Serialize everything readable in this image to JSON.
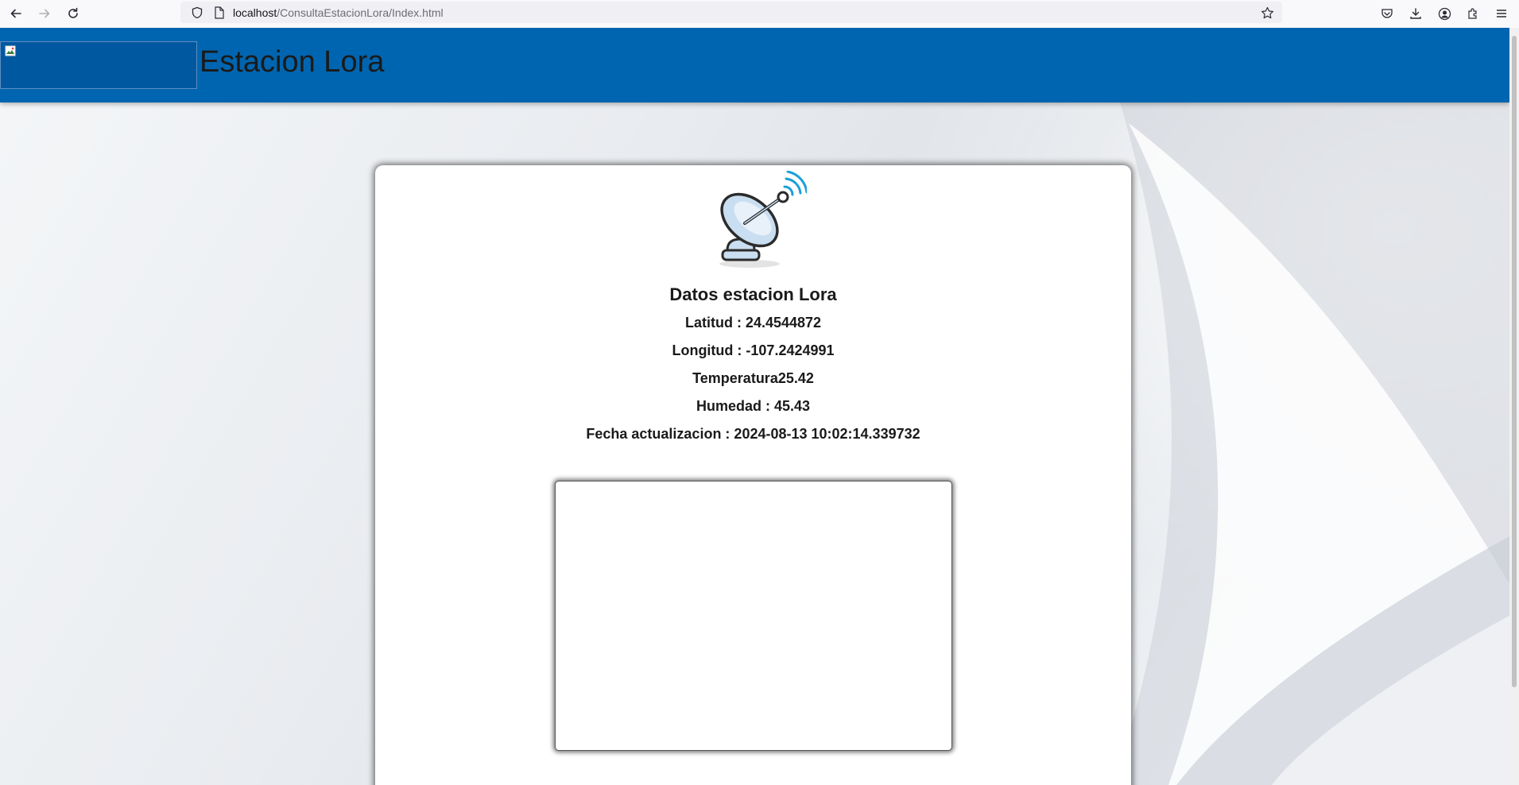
{
  "browser": {
    "url_host": "localhost",
    "url_path": "/ConsultaEstacionLora/Index.html"
  },
  "header": {
    "title": "Estacion Lora",
    "background_color": "#0065b0"
  },
  "card": {
    "title": "Datos estacion Lora",
    "icon": "satellite-dish-icon",
    "fields": [
      {
        "label": "Latitud : 24.4544872"
      },
      {
        "label": "Longitud : -107.2424991"
      },
      {
        "label": "Temperatura25.42"
      },
      {
        "label": "Humedad : 45.43"
      },
      {
        "label": "Fecha actualizacion : 2024-08-13 10:02:14.339732"
      }
    ]
  },
  "colors": {
    "accent_signal": "#1aa0d8",
    "dish_fill": "#c9def0"
  }
}
